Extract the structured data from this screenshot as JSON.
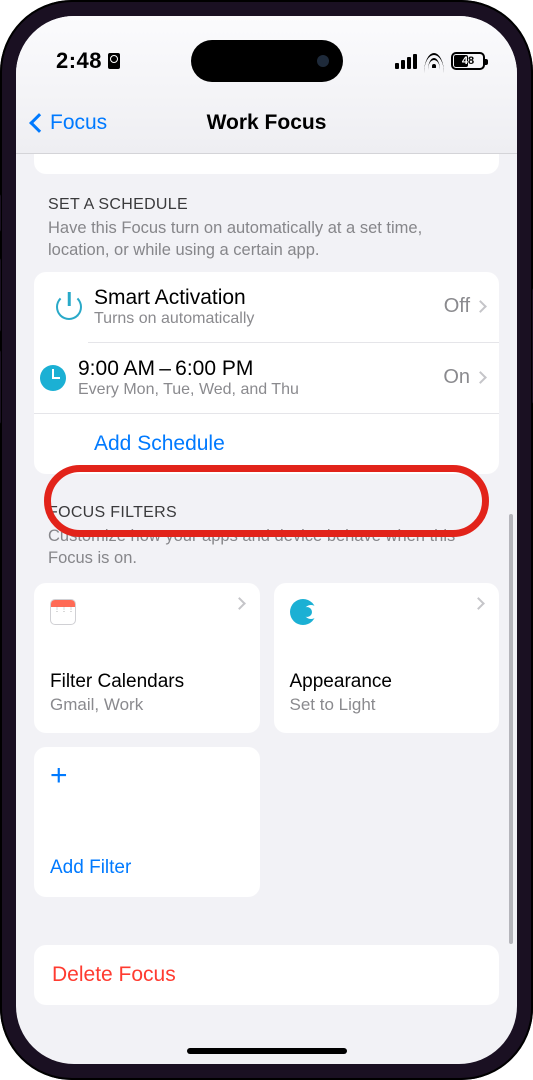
{
  "status": {
    "time": "2:48",
    "battery": "48"
  },
  "nav": {
    "back": "Focus",
    "title": "Work Focus"
  },
  "schedule": {
    "header": "SET A SCHEDULE",
    "desc": "Have this Focus turn on automatically at a set time, location, or while using a certain app.",
    "rows": [
      {
        "title": "Smart Activation",
        "sub": "Turns on automatically",
        "value": "Off"
      },
      {
        "title": "9:00 AM – 6:00 PM",
        "sub": "Every Mon, Tue, Wed, and Thu",
        "value": "On"
      }
    ],
    "add": "Add Schedule"
  },
  "filters": {
    "header": "FOCUS FILTERS",
    "desc": "Customize how your apps and device behave when this Focus is on.",
    "items": [
      {
        "title": "Filter Calendars",
        "sub": "Gmail, Work"
      },
      {
        "title": "Appearance",
        "sub": "Set to Light"
      }
    ],
    "add": "Add Filter"
  },
  "delete": "Delete Focus"
}
